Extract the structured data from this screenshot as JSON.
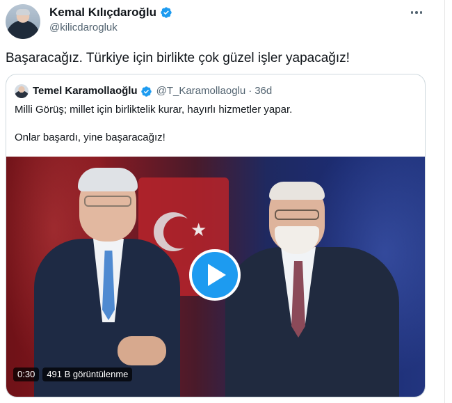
{
  "author": {
    "name": "Kemal Kılıçdaroğlu",
    "handle": "@kilicdarogluk",
    "verified": true
  },
  "tweet": {
    "text": "Başaracağız. Türkiye için birlikte çok güzel işler yapacağız!"
  },
  "quoted": {
    "name": "Temel Karamollaoğlu",
    "handle": "@T_Karamollaoglu",
    "separator": "·",
    "time": "36d",
    "line1": "Milli Görüş; millet için birliktelik kurar, hayırlı hizmetler yapar.",
    "line2": "Onlar başardı, yine başaracağız!",
    "verified": true
  },
  "video": {
    "duration": "0:30",
    "views": "491 B görüntülenme"
  },
  "colors": {
    "accent": "#1d9bf0",
    "secondary_text": "#536471",
    "border": "#cfd9de"
  },
  "icons": [
    "verified-badge-icon",
    "more-options-icon",
    "play-icon"
  ]
}
